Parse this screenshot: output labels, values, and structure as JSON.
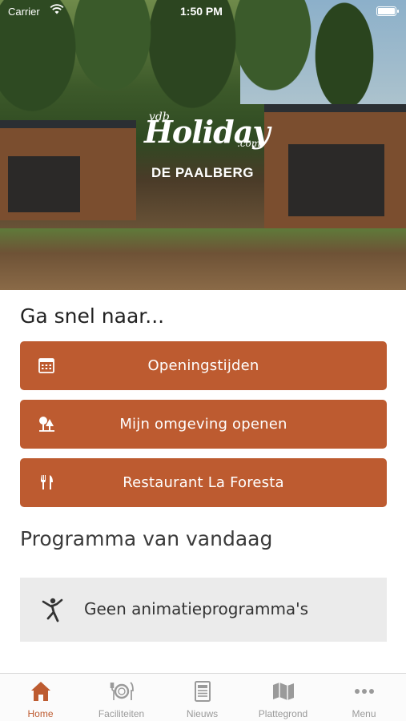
{
  "status_bar": {
    "carrier": "Carrier",
    "time": "1:50 PM"
  },
  "hero": {
    "logo_prefix": "vdb",
    "logo_brand": "Holiday",
    "logo_suffix": ".com",
    "location": "DE PAALBERG"
  },
  "quick_links": {
    "title": "Ga snel naar...",
    "buttons": [
      {
        "label": "Openingstijden",
        "icon": "calendar-icon"
      },
      {
        "label": "Mijn omgeving openen",
        "icon": "trees-icon"
      },
      {
        "label": "Restaurant La Foresta",
        "icon": "cutlery-icon"
      }
    ]
  },
  "program": {
    "title": "Programma van vandaag",
    "empty_text": "Geen animatieprogramma's",
    "empty_icon": "dancer-icon"
  },
  "tabbar": {
    "active": "Home",
    "tabs": [
      {
        "label": "Home",
        "icon": "home-icon"
      },
      {
        "label": "Faciliteiten",
        "icon": "plate-cutlery-icon"
      },
      {
        "label": "Nieuws",
        "icon": "newspaper-icon"
      },
      {
        "label": "Plattegrond",
        "icon": "map-icon"
      },
      {
        "label": "Menu",
        "icon": "more-dots-icon"
      }
    ]
  },
  "colors": {
    "accent": "#bd5b30",
    "empty_bg": "#ebebeb",
    "tab_inactive": "#9a9a9a"
  }
}
